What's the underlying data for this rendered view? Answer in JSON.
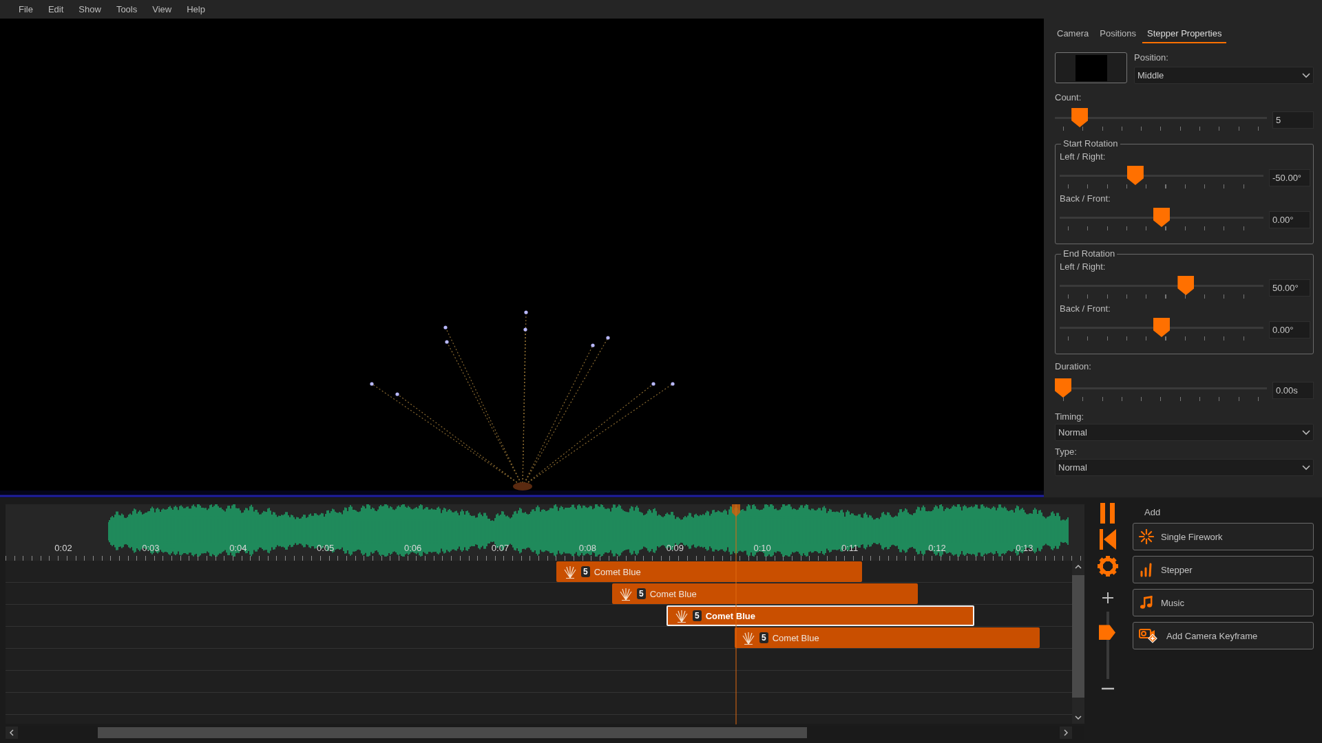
{
  "menu": [
    "File",
    "Edit",
    "Show",
    "Tools",
    "View",
    "Help"
  ],
  "tabs": [
    {
      "label": "Camera",
      "selected": false
    },
    {
      "label": "Positions",
      "selected": false
    },
    {
      "label": "Stepper Properties",
      "selected": true
    }
  ],
  "properties": {
    "position": {
      "label": "Position:",
      "value": "Middle"
    },
    "count": {
      "label": "Count:",
      "level": 0.085,
      "value": "5"
    },
    "start_rotation": {
      "title": "Start Rotation",
      "sliders": [
        {
          "label": "Left / Right:",
          "level": 0.36,
          "value": "-50.00°"
        },
        {
          "label": "Back / Front:",
          "level": 0.5,
          "value": "0.00°"
        }
      ]
    },
    "end_rotation": {
      "title": "End Rotation",
      "sliders": [
        {
          "label": "Left / Right:",
          "level": 0.63,
          "value": "50.00°"
        },
        {
          "label": "Back / Front:",
          "level": 0.5,
          "value": "0.00°"
        }
      ]
    },
    "duration": {
      "label": "Duration:",
      "level": 0,
      "value": "0.00s"
    },
    "timing": {
      "label": "Timing:",
      "value": "Normal"
    },
    "type": {
      "label": "Type:",
      "value": "Normal"
    }
  },
  "timeline": {
    "ruler": [
      "0:02",
      "0:03",
      "0:04",
      "0:05",
      "0:06",
      "0:07",
      "0:08",
      "0:09",
      "0:10",
      "0:11",
      "0:12",
      "0:13"
    ],
    "clips": [
      {
        "count": "5",
        "name": "Comet Blue",
        "selected": false
      },
      {
        "count": "5",
        "name": "Comet Blue",
        "selected": false
      },
      {
        "count": "5",
        "name": "Comet Blue",
        "selected": true
      },
      {
        "count": "5",
        "name": "Comet Blue",
        "selected": false
      }
    ],
    "zoom": {
      "level": 0.69
    }
  },
  "add_panel": {
    "title": "Add",
    "buttons": [
      {
        "kind": "firework",
        "label": "Single Firework"
      },
      {
        "kind": "stepper",
        "label": "Stepper"
      },
      {
        "kind": "music",
        "label": "Music"
      },
      {
        "kind": "camera",
        "label": "Add Camera Keyframe"
      }
    ]
  }
}
